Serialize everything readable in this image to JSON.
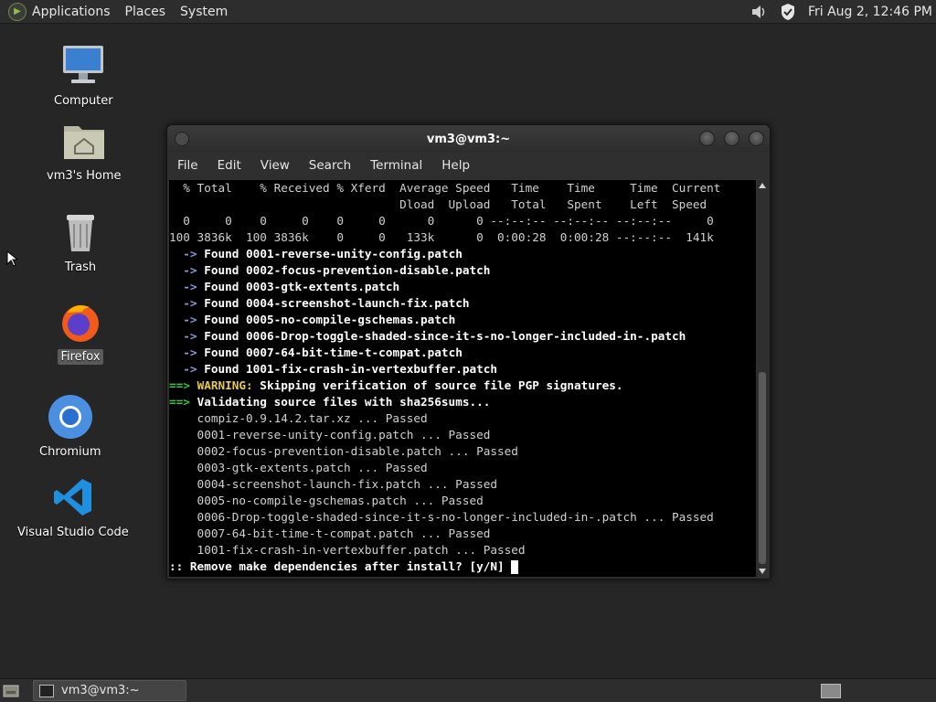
{
  "top_panel": {
    "menus": [
      "Applications",
      "Places",
      "System"
    ],
    "clock": "Fri Aug  2, 12:46 PM"
  },
  "desktop_icons": [
    {
      "label": "Computer"
    },
    {
      "label": "vm3's Home"
    },
    {
      "label": "Trash"
    },
    {
      "label": "Firefox"
    },
    {
      "label": "Chromium"
    },
    {
      "label": "Visual Studio Code"
    }
  ],
  "window": {
    "title": "vm3@vm3:~",
    "menus": [
      "File",
      "Edit",
      "View",
      "Search",
      "Terminal",
      "Help"
    ]
  },
  "terminal": {
    "curl_header1": "  % Total    % Received % Xferd  Average Speed   Time    Time     Time  Current",
    "curl_header2": "                                 Dload  Upload   Total   Spent    Left  Speed",
    "curl_row1": "  0     0    0     0    0     0      0      0 --:--:-- --:--:-- --:--:--     0",
    "curl_row2": "100 3836k  100 3836k    0     0   133k      0  0:00:28  0:00:28 --:--:--  141k",
    "found_prefix": "  -> ",
    "found_label": "Found ",
    "found": [
      "0001-reverse-unity-config.patch",
      "0002-focus-prevention-disable.patch",
      "0003-gtk-extents.patch",
      "0004-screenshot-launch-fix.patch",
      "0005-no-compile-gschemas.patch",
      "0006-Drop-toggle-shaded-since-it-s-no-longer-included-in-.patch",
      "0007-64-bit-time-t-compat.patch",
      "1001-fix-crash-in-vertexbuffer.patch"
    ],
    "arrow": "==> ",
    "warning_label": "WARNING:",
    "warning_text": " Skipping verification of source file PGP signatures.",
    "validating": "Validating source files with sha256sums...",
    "checks": [
      "    compiz-0.9.14.2.tar.xz ... Passed",
      "    0001-reverse-unity-config.patch ... Passed",
      "    0002-focus-prevention-disable.patch ... Passed",
      "    0003-gtk-extents.patch ... Passed",
      "    0004-screenshot-launch-fix.patch ... Passed",
      "    0005-no-compile-gschemas.patch ... Passed",
      "    0006-Drop-toggle-shaded-since-it-s-no-longer-included-in-.patch ... Passed",
      "    0007-64-bit-time-t-compat.patch ... Passed",
      "    1001-fix-crash-in-vertexbuffer.patch ... Passed"
    ],
    "prompt": ":: Remove make dependencies after install? [y/N] "
  },
  "bottom_panel": {
    "task_label": "vm3@vm3:~"
  },
  "colors": {
    "desktop_bg": "#262626",
    "terminal_bg": "#000000",
    "arrow_blue": "#8a9ad8",
    "green": "#33cc33",
    "warning_yellow": "#e6c84a"
  }
}
